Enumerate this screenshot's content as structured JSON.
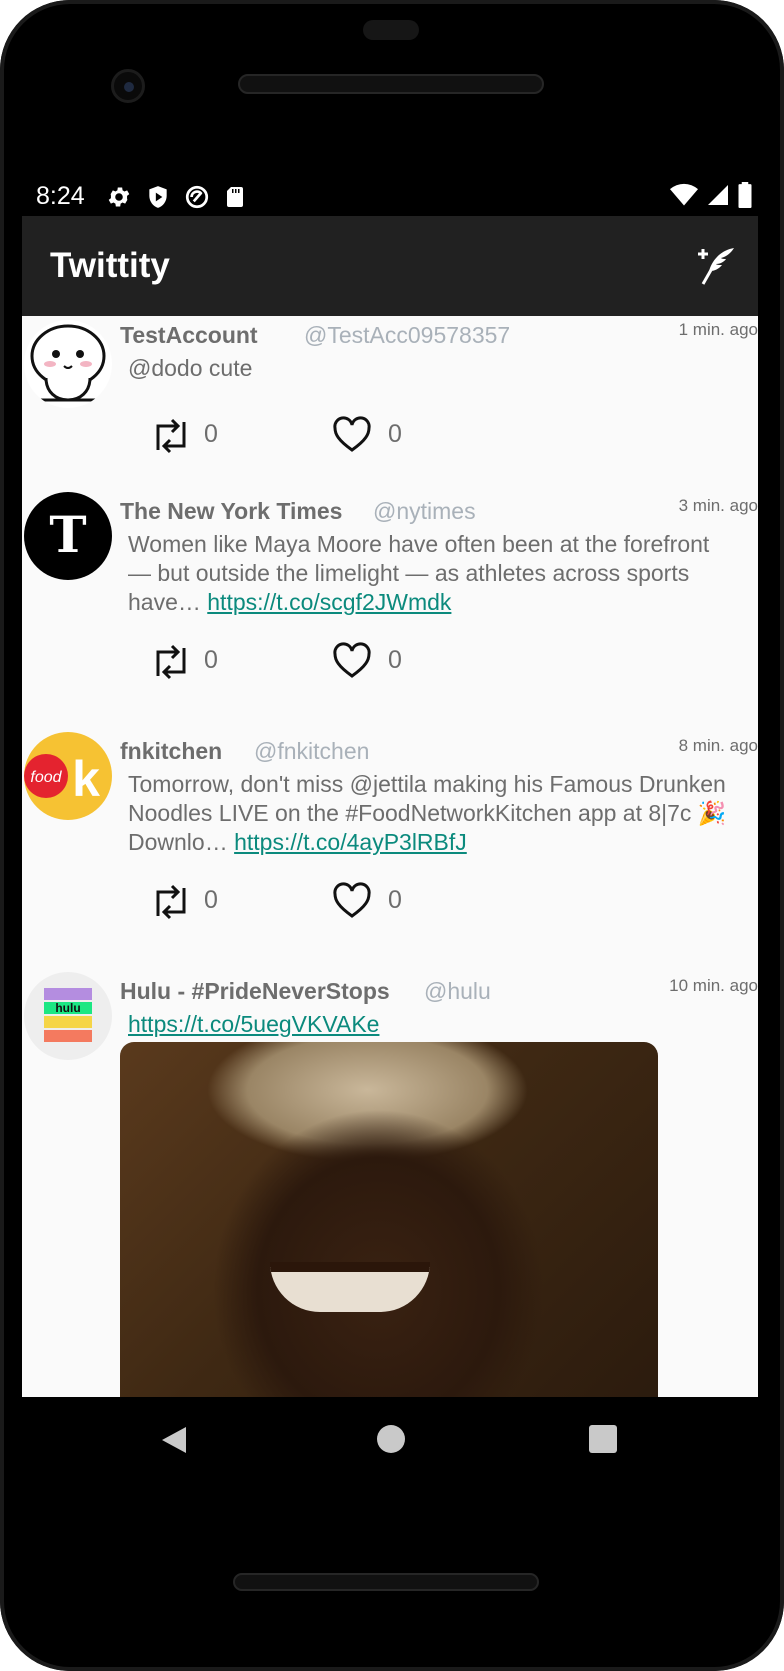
{
  "status": {
    "time": "8:24"
  },
  "app": {
    "title": "Twittity"
  },
  "tweets": [
    {
      "name": "TestAccount",
      "handle": "@TestAcc09578357",
      "time": "1 min. ago",
      "text": "@dodo cute",
      "link": "",
      "retweets": "0",
      "likes": "0"
    },
    {
      "name": "The New York Times",
      "handle": "@nytimes",
      "time": "3 min. ago",
      "text": "Women like Maya Moore have often been at the forefront — but outside the limelight — as athletes across sports have… ",
      "link": "https://t.co/scgf2JWmdk",
      "retweets": "0",
      "likes": "0"
    },
    {
      "name": "fnkitchen",
      "handle": "@fnkitchen",
      "time": "8 min. ago",
      "text": "Tomorrow, don't miss @jettila making his Famous Drunken Noodles LIVE on the #FoodNetworkKitchen app at 8|7c 🎉Downlo… ",
      "link": "https://t.co/4ayP3lRBfJ",
      "retweets": "0",
      "likes": "0",
      "avatar_text": "food"
    },
    {
      "name": "Hulu - #PrideNeverStops",
      "handle": "@hulu",
      "time": "10 min. ago",
      "text": "",
      "link": "https://t.co/5uegVKVAKe",
      "avatar_text": "hulu"
    }
  ],
  "colors": {
    "toolbar": "#212121",
    "link": "#0b8a7d",
    "text": "#6d6d6d",
    "handle": "#a9b1b9"
  }
}
